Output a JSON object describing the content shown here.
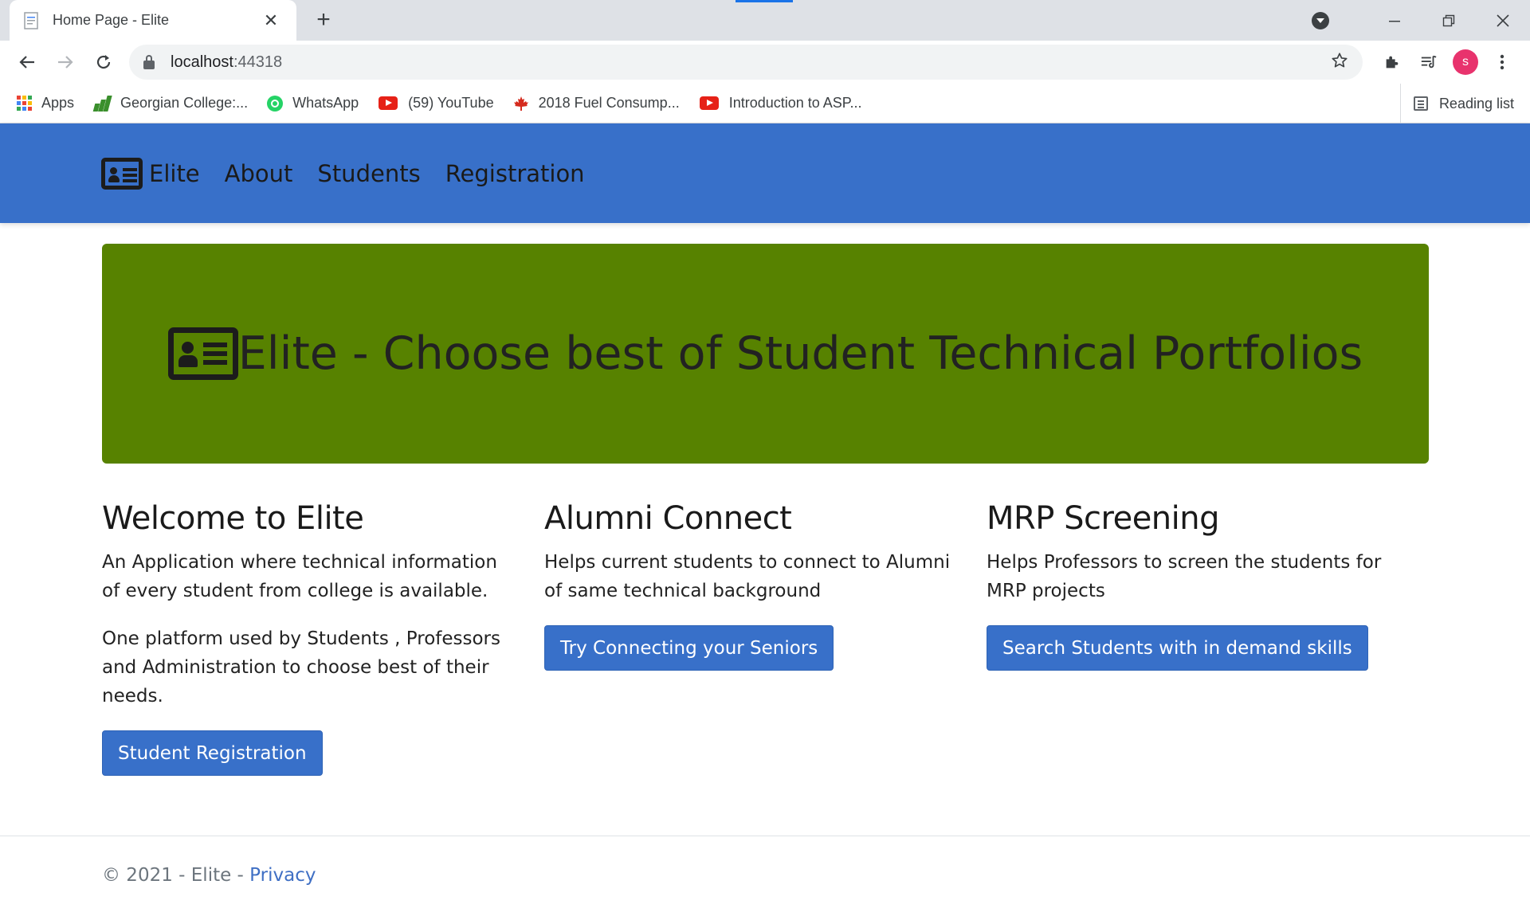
{
  "browser": {
    "tab_title": "Home Page - Elite",
    "new_tab_glyph": "+",
    "close_glyph": "✕",
    "url_host": "localhost",
    "url_port": ":44318",
    "profile_initial": "s",
    "bookmarks": [
      {
        "label": "Apps",
        "icon": "apps-grid-icon"
      },
      {
        "label": "Georgian College:...",
        "icon": "georgian-college-icon"
      },
      {
        "label": "WhatsApp",
        "icon": "whatsapp-icon"
      },
      {
        "label": "(59) YouTube",
        "icon": "youtube-icon"
      },
      {
        "label": "2018 Fuel Consump...",
        "icon": "maple-leaf-icon"
      },
      {
        "label": "Introduction to ASP...",
        "icon": "youtube-icon"
      }
    ],
    "reading_list": "Reading list"
  },
  "nav": {
    "brand": "Elite",
    "links": [
      "About",
      "Students",
      "Registration"
    ],
    "background": "#3870c9"
  },
  "jumbotron": {
    "title": "Elite - Choose best of Student Technical Portfolios",
    "background": "#578200"
  },
  "columns": [
    {
      "heading": "Welcome to Elite",
      "paragraphs": [
        "An Application where technical information of every student from college is available.",
        "One platform used by Students , Professors and Administration to choose best of their needs."
      ],
      "button": "Student Registration"
    },
    {
      "heading": "Alumni Connect",
      "paragraphs": [
        "Helps current students to connect to Alumni of same technical background"
      ],
      "button": "Try Connecting your Seniors"
    },
    {
      "heading": "MRP Screening",
      "paragraphs": [
        "Helps Professors to screen the students for MRP projects"
      ],
      "button": "Search Students with in demand skills"
    }
  ],
  "footer": {
    "text": "© 2021 - Elite - ",
    "privacy_link": "Privacy"
  }
}
